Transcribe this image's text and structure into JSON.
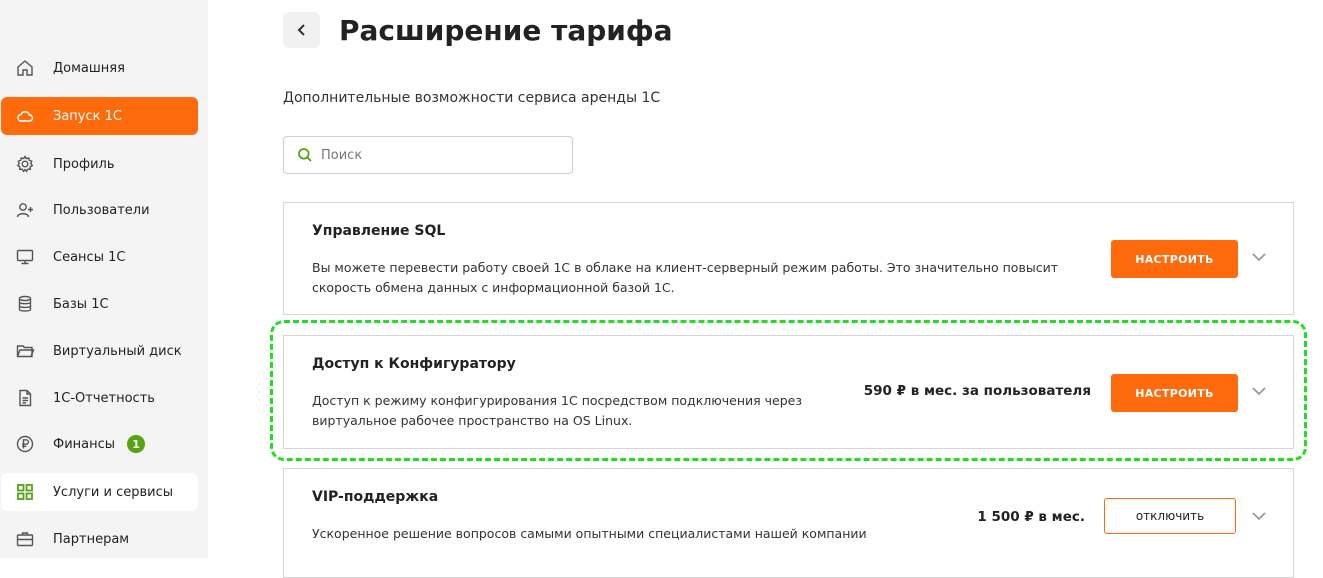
{
  "sidebar": {
    "items": [
      {
        "label": "Домашняя",
        "icon": "home-icon"
      },
      {
        "label": "Запуск 1С",
        "icon": "cloud-icon"
      },
      {
        "label": "Профиль",
        "icon": "gear-icon"
      },
      {
        "label": "Пользователи",
        "icon": "user-plus-icon"
      },
      {
        "label": "Сеансы 1С",
        "icon": "monitor-icon"
      },
      {
        "label": "Базы 1С",
        "icon": "database-icon"
      },
      {
        "label": "Виртуальный диск",
        "icon": "folder-icon"
      },
      {
        "label": "1С-Отчетность",
        "icon": "document-icon"
      },
      {
        "label": "Финансы",
        "icon": "ruble-icon",
        "badge": "1"
      },
      {
        "label": "Услуги и сервисы",
        "icon": "grid-icon"
      },
      {
        "label": "Партнерам",
        "icon": "briefcase-icon"
      }
    ],
    "active_color": "#ff6a0d",
    "badge_color": "#55a313"
  },
  "header": {
    "title": "Расширение тарифа",
    "subtitle": "Дополнительные возможности сервиса аренды 1С"
  },
  "search": {
    "placeholder": "Поиск"
  },
  "services": [
    {
      "title": "Управление SQL",
      "description": "Вы можете перевести работу своей 1С в облаке на клиент-серверный режим работы. Это значительно повысит скорость обмена данных с информационной базой 1С.",
      "price": "",
      "button": "НАСТРОИТЬ"
    },
    {
      "title": "Доступ к Конфигуратору",
      "description": "Доступ к режиму конфигурирования 1С посредством подключения через виртуальное рабочее пространство на OS Linux.",
      "price": "590 ₽ в мес. за пользователя",
      "button": "НАСТРОИТЬ"
    },
    {
      "title": "VIP-поддержка",
      "description": "Ускоренное решение вопросов самыми опытными специалистами нашей компании",
      "price": "1 500 ₽ в мес.",
      "button": "отключить"
    }
  ],
  "colors": {
    "accent": "#ff6a0d",
    "highlight": "#22dd22"
  }
}
